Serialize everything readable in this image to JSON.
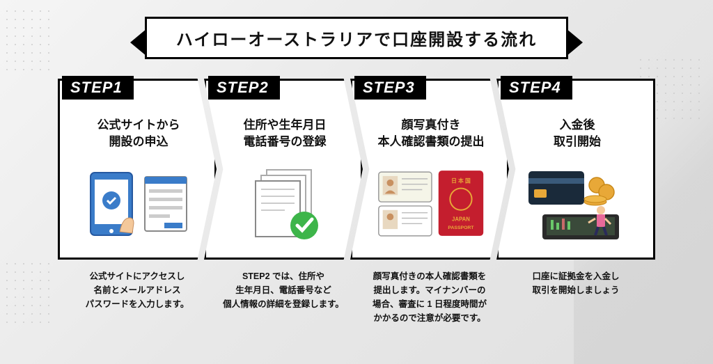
{
  "title": "ハイローオーストラリアで口座開設する流れ",
  "steps": [
    {
      "label": "STEP1",
      "heading": "公式サイトから\n開設の申込",
      "desc": "公式サイトにアクセスし\n名前とメールアドレス\nパスワードを入力します。"
    },
    {
      "label": "STEP2",
      "heading": "住所や生年月日\n電話番号の登録",
      "desc": "STEP2 では、住所や\n生年月日、電話番号など\n個人情報の詳細を登録します。"
    },
    {
      "label": "STEP3",
      "heading": "顔写真付き\n本人確認書類の提出",
      "desc": "顔写真付きの本人確認書類を\n提出します。マイナンバーの\n場合、審査に 1 日程度時間が\nかかるので注意が必要です。"
    },
    {
      "label": "STEP4",
      "heading": "入金後\n取引開始",
      "desc": "口座に証拠金を入金し\n取引を開始しましょう"
    }
  ]
}
